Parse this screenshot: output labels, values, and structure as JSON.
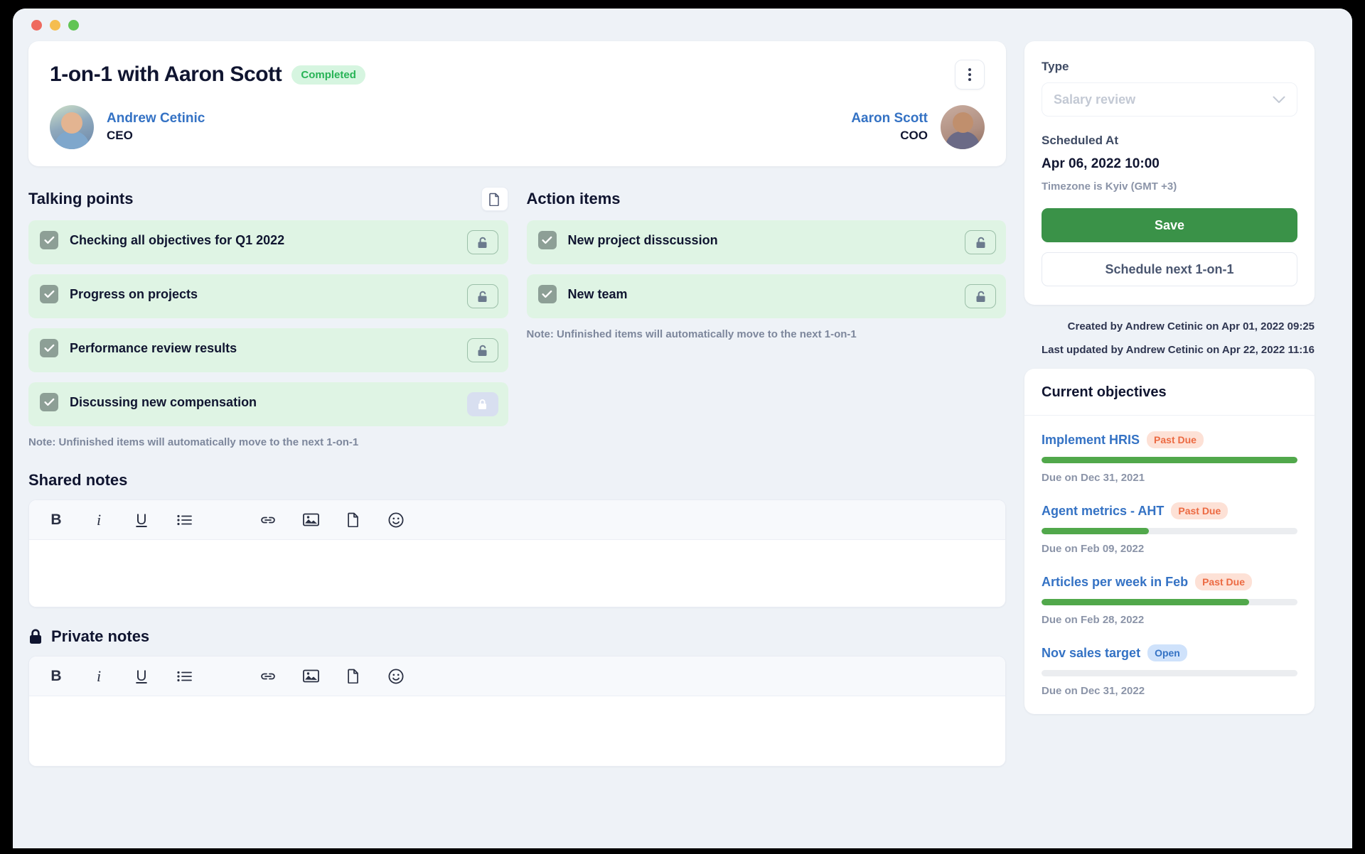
{
  "window": {
    "traffic_lights": [
      "close",
      "minimize",
      "maximize"
    ]
  },
  "header": {
    "title": "1-on-1 with Aaron Scott",
    "status": "Completed",
    "menu_icon": "kebab-menu-icon",
    "people": [
      {
        "name": "Andrew Cetinic",
        "role": "CEO"
      },
      {
        "name": "Aaron Scott",
        "role": "COO"
      }
    ]
  },
  "talking_points": {
    "heading": "Talking points",
    "doc_icon": "document-icon",
    "items": [
      {
        "label": "Checking all objectives for Q1 2022",
        "checked": true,
        "locked": false
      },
      {
        "label": "Progress on projects",
        "checked": true,
        "locked": false
      },
      {
        "label": "Performance review results",
        "checked": true,
        "locked": false
      },
      {
        "label": "Discussing new compensation",
        "checked": true,
        "locked": true
      }
    ],
    "note": "Note: Unfinished items will automatically move to the next 1-on-1"
  },
  "action_items": {
    "heading": "Action items",
    "items": [
      {
        "label": "New project disscussion",
        "checked": true,
        "locked": false
      },
      {
        "label": "New team",
        "checked": true,
        "locked": false
      }
    ],
    "note": "Note: Unfinished items will automatically move to the next 1-on-1"
  },
  "shared_notes": {
    "heading": "Shared notes",
    "content": "",
    "toolbar": [
      {
        "icon": "bold-icon",
        "label": "B"
      },
      {
        "icon": "italic-icon",
        "label": "i"
      },
      {
        "icon": "underline-icon",
        "label": "U"
      },
      {
        "icon": "bullet-list-icon",
        "label": ""
      },
      {
        "icon": "link-icon",
        "label": ""
      },
      {
        "icon": "image-icon",
        "label": ""
      },
      {
        "icon": "file-icon",
        "label": ""
      },
      {
        "icon": "emoji-icon",
        "label": ""
      }
    ]
  },
  "private_notes": {
    "heading": "Private notes",
    "lock_icon": "lock-icon",
    "content": "",
    "toolbar": [
      {
        "icon": "bold-icon",
        "label": "B"
      },
      {
        "icon": "italic-icon",
        "label": "i"
      },
      {
        "icon": "underline-icon",
        "label": "U"
      },
      {
        "icon": "bullet-list-icon",
        "label": ""
      },
      {
        "icon": "link-icon",
        "label": ""
      },
      {
        "icon": "image-icon",
        "label": ""
      },
      {
        "icon": "file-icon",
        "label": ""
      },
      {
        "icon": "emoji-icon",
        "label": ""
      }
    ]
  },
  "sidebar": {
    "type_label": "Type",
    "type_value": "Salary review",
    "scheduled_label": "Scheduled At",
    "scheduled_value": "Apr 06, 2022 10:00",
    "timezone": "Timezone is Kyiv (GMT +3)",
    "save_label": "Save",
    "schedule_next_label": "Schedule next 1-on-1",
    "created_by": "Created by Andrew Cetinic on Apr 01, 2022 09:25",
    "last_updated": "Last updated by Andrew Cetinic on Apr 22, 2022 11:16",
    "objectives_heading": "Current objectives",
    "objectives": [
      {
        "name": "Implement HRIS",
        "badge": "Past Due",
        "badge_type": "pastdue",
        "progress": 100,
        "due": "Due on Dec 31, 2021"
      },
      {
        "name": "Agent metrics - AHT",
        "badge": "Past Due",
        "badge_type": "pastdue",
        "progress": 42,
        "due": "Due on Feb 09, 2022"
      },
      {
        "name": "Articles per week in Feb",
        "badge": "Past Due",
        "badge_type": "pastdue",
        "progress": 81,
        "due": "Due on Feb 28, 2022"
      },
      {
        "name": "Nov sales target",
        "badge": "Open",
        "badge_type": "open",
        "progress": 0,
        "due": "Due on Dec 31, 2022"
      }
    ]
  },
  "colors": {
    "accent_blue": "#3472c4",
    "green": "#3a9248",
    "progress_green": "#51a84b",
    "item_bg": "#dff4e4",
    "badge_green_bg": "#d6f5e0",
    "badge_green_text": "#27b355",
    "pastdue_bg": "#fde1d6",
    "pastdue_text": "#ec6a42",
    "open_bg": "#cfe2fb",
    "page_bg": "#eef2f7"
  }
}
